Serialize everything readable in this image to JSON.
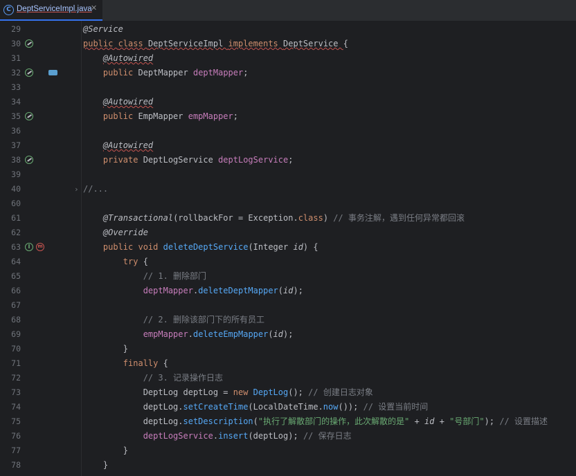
{
  "tab": {
    "title": "DeptServiceImpl.java",
    "icon": "java-class-icon",
    "close": "✕"
  },
  "lines": [
    {
      "n": "29",
      "parts": [
        {
          "t": "@Service",
          "c": "ann itl"
        }
      ]
    },
    {
      "n": "30",
      "parts": [
        {
          "t": "public ",
          "c": "kw wavy"
        },
        {
          "t": "class ",
          "c": "kw wavy"
        },
        {
          "t": "DeptServiceImpl ",
          "c": "wavy"
        },
        {
          "t": "implements ",
          "c": "kw wavy"
        },
        {
          "t": "DeptService ",
          "c": "wavy"
        },
        {
          "t": "{"
        }
      ]
    },
    {
      "n": "31",
      "parts": [
        {
          "t": "    "
        },
        {
          "t": "@Autowired",
          "c": "ann itl wavy"
        }
      ]
    },
    {
      "n": "32",
      "parts": [
        {
          "t": "    "
        },
        {
          "t": "public ",
          "c": "kw"
        },
        {
          "t": "DeptMapper "
        },
        {
          "t": "deptMapper",
          "c": "fld"
        },
        {
          "t": ";"
        }
      ]
    },
    {
      "n": "33",
      "parts": []
    },
    {
      "n": "34",
      "parts": [
        {
          "t": "    "
        },
        {
          "t": "@Autowired",
          "c": "ann itl wavy"
        }
      ]
    },
    {
      "n": "35",
      "parts": [
        {
          "t": "    "
        },
        {
          "t": "public ",
          "c": "kw"
        },
        {
          "t": "EmpMapper "
        },
        {
          "t": "empMapper",
          "c": "fld"
        },
        {
          "t": ";"
        }
      ]
    },
    {
      "n": "36",
      "parts": []
    },
    {
      "n": "37",
      "parts": [
        {
          "t": "    "
        },
        {
          "t": "@Autowired",
          "c": "ann itl wavy"
        }
      ]
    },
    {
      "n": "38",
      "parts": [
        {
          "t": "    "
        },
        {
          "t": "private ",
          "c": "kw"
        },
        {
          "t": "DeptLogService "
        },
        {
          "t": "deptLogService",
          "c": "fld"
        },
        {
          "t": ";"
        }
      ]
    },
    {
      "n": "39",
      "parts": []
    },
    {
      "n": "40",
      "parts": [
        {
          "t": "//...",
          "c": "fold"
        }
      ]
    },
    {
      "n": "60",
      "parts": []
    },
    {
      "n": "61",
      "parts": [
        {
          "t": "    "
        },
        {
          "t": "@Transactional",
          "c": "ann itl"
        },
        {
          "t": "(rollbackFor = Exception."
        },
        {
          "t": "class",
          "c": "kw"
        },
        {
          "t": ") "
        },
        {
          "t": "// 事务注解，遇到任何异常都回滚",
          "c": "cmt"
        }
      ]
    },
    {
      "n": "62",
      "parts": [
        {
          "t": "    "
        },
        {
          "t": "@Override",
          "c": "ann itl"
        }
      ]
    },
    {
      "n": "63",
      "parts": [
        {
          "t": "    "
        },
        {
          "t": "public ",
          "c": "kw"
        },
        {
          "t": "void ",
          "c": "kw"
        },
        {
          "t": "deleteDeptService",
          "c": "fn"
        },
        {
          "t": "(Integer "
        },
        {
          "t": "id",
          "c": "itl"
        },
        {
          "t": ") {"
        }
      ]
    },
    {
      "n": "64",
      "parts": [
        {
          "t": "        "
        },
        {
          "t": "try ",
          "c": "kw"
        },
        {
          "t": "{"
        }
      ]
    },
    {
      "n": "65",
      "parts": [
        {
          "t": "            "
        },
        {
          "t": "// 1. 删除部门",
          "c": "cmt"
        }
      ]
    },
    {
      "n": "66",
      "parts": [
        {
          "t": "            "
        },
        {
          "t": "deptMapper",
          "c": "fld"
        },
        {
          "t": "."
        },
        {
          "t": "deleteDeptMapper",
          "c": "fn"
        },
        {
          "t": "("
        },
        {
          "t": "id",
          "c": "itl"
        },
        {
          "t": ");"
        }
      ]
    },
    {
      "n": "67",
      "parts": []
    },
    {
      "n": "68",
      "parts": [
        {
          "t": "            "
        },
        {
          "t": "// 2. 删除该部门下的所有员工",
          "c": "cmt"
        }
      ]
    },
    {
      "n": "69",
      "parts": [
        {
          "t": "            "
        },
        {
          "t": "empMapper",
          "c": "fld"
        },
        {
          "t": "."
        },
        {
          "t": "deleteEmpMapper",
          "c": "fn"
        },
        {
          "t": "("
        },
        {
          "t": "id",
          "c": "itl"
        },
        {
          "t": ");"
        }
      ]
    },
    {
      "n": "70",
      "parts": [
        {
          "t": "        }"
        }
      ]
    },
    {
      "n": "71",
      "parts": [
        {
          "t": "        "
        },
        {
          "t": "finally ",
          "c": "kw"
        },
        {
          "t": "{"
        }
      ]
    },
    {
      "n": "72",
      "parts": [
        {
          "t": "            "
        },
        {
          "t": "// 3. 记录操作日志",
          "c": "cmt"
        }
      ]
    },
    {
      "n": "73",
      "parts": [
        {
          "t": "            DeptLog deptLog = "
        },
        {
          "t": "new ",
          "c": "kw"
        },
        {
          "t": "DeptLog",
          "c": "fn"
        },
        {
          "t": "(); "
        },
        {
          "t": "// 创建日志对象",
          "c": "cmt"
        }
      ]
    },
    {
      "n": "74",
      "parts": [
        {
          "t": "            deptLog."
        },
        {
          "t": "setCreateTime",
          "c": "fn"
        },
        {
          "t": "(LocalDateTime."
        },
        {
          "t": "now",
          "c": "fn"
        },
        {
          "t": "()); "
        },
        {
          "t": "// 设置当前时间",
          "c": "cmt"
        }
      ]
    },
    {
      "n": "75",
      "parts": [
        {
          "t": "            deptLog."
        },
        {
          "t": "setDescription",
          "c": "fn"
        },
        {
          "t": "("
        },
        {
          "t": "\"执行了解散部门的操作，此次解散的是\"",
          "c": "str"
        },
        {
          "t": " + "
        },
        {
          "t": "id",
          "c": "itl"
        },
        {
          "t": " + "
        },
        {
          "t": "\"号部门\"",
          "c": "str"
        },
        {
          "t": "); "
        },
        {
          "t": "// 设置描述",
          "c": "cmt"
        }
      ]
    },
    {
      "n": "76",
      "parts": [
        {
          "t": "            "
        },
        {
          "t": "deptLogService",
          "c": "fld"
        },
        {
          "t": "."
        },
        {
          "t": "insert",
          "c": "fn"
        },
        {
          "t": "(deptLog); "
        },
        {
          "t": "// 保存日志",
          "c": "cmt"
        }
      ]
    },
    {
      "n": "77",
      "parts": [
        {
          "t": "        }"
        }
      ]
    },
    {
      "n": "78",
      "parts": [
        {
          "t": "    }"
        }
      ]
    }
  ],
  "gutter_icons": [
    {
      "line": "30",
      "icon": "spring-bean-icon"
    },
    {
      "line": "32",
      "icon": "spring-bean-icon"
    },
    {
      "line": "32",
      "icon": "mybatis-mapper-icon"
    },
    {
      "line": "35",
      "icon": "spring-bean-icon"
    },
    {
      "line": "38",
      "icon": "spring-bean-icon"
    },
    {
      "line": "40",
      "icon": "fold-expand-icon"
    },
    {
      "line": "63",
      "icon": "implements-method-icon"
    },
    {
      "line": "63",
      "icon": "overrides-method-icon"
    }
  ],
  "colors": {
    "background": "#1e1f22",
    "keyword": "#cf8e6d",
    "annotation": "#b3ae60",
    "field": "#c77dbb",
    "method": "#56a8f5",
    "string": "#6aab73",
    "comment": "#7a7e85",
    "text": "#bcbec4"
  }
}
